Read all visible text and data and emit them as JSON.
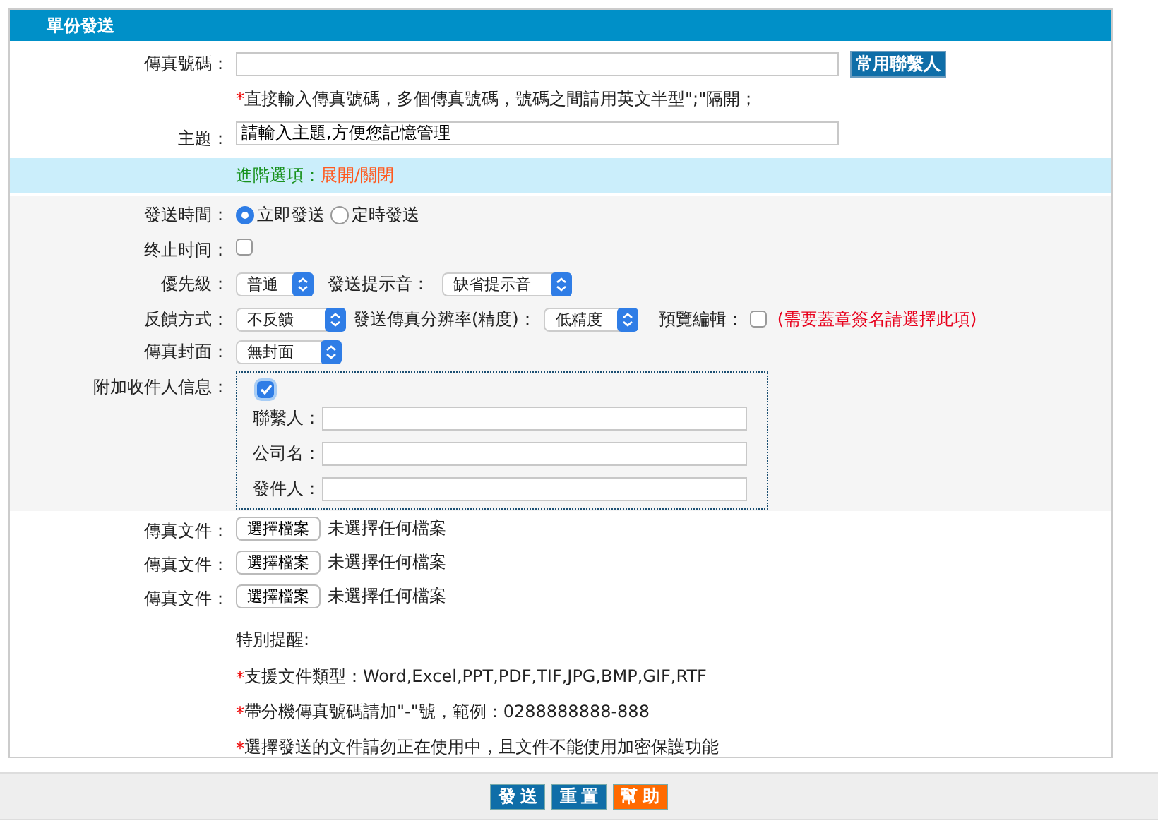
{
  "panel": {
    "title": "單份發送"
  },
  "fax_number": {
    "label": "傳真號碼：",
    "button": "常用聯繫人"
  },
  "fax_hint": {
    "mark": "*",
    "text": "直接輸入傳真號碼，多個傳真號碼，號碼之間請用英文半型\";\"隔開；"
  },
  "subject": {
    "label": "主題：",
    "value": "請輸入主題,方便您記憶管理"
  },
  "advanced": {
    "label": "進階選項：",
    "link": "展開/關閉"
  },
  "send_time": {
    "label": "發送時間：",
    "options": [
      {
        "label": "立即發送",
        "selected": true
      },
      {
        "label": "定時發送",
        "selected": false
      }
    ]
  },
  "stop_time": {
    "label": "终止时间：",
    "checked": false
  },
  "priority": {
    "label": "優先級：",
    "value": "普通"
  },
  "sound": {
    "label": "發送提示音：",
    "value": "缺省提示音"
  },
  "feedback": {
    "label": "反饋方式：",
    "value": "不反饋"
  },
  "resolution": {
    "label": "發送傳真分辨率(精度)：",
    "value": "低精度"
  },
  "preview": {
    "label": "預覽編輯：",
    "checked": false,
    "note": "(需要蓋章簽名請選擇此項)"
  },
  "cover": {
    "label": "傳真封面：",
    "value": "無封面"
  },
  "recipient_info": {
    "label": "附加收件人信息：",
    "checked": true,
    "fields": [
      {
        "label": "聯繫人："
      },
      {
        "label": "公司名："
      },
      {
        "label": "發件人："
      }
    ]
  },
  "files": [
    {
      "label": "傳真文件：",
      "button": "選擇檔案",
      "status": "未選擇任何檔案"
    },
    {
      "label": "傳真文件：",
      "button": "選擇檔案",
      "status": "未選擇任何檔案"
    },
    {
      "label": "傳真文件：",
      "button": "選擇檔案",
      "status": "未選擇任何檔案"
    }
  ],
  "reminder": {
    "title": "特別提醒:",
    "notes": [
      {
        "mark": "*",
        "text": "支援文件類型：Word,Excel,PPT,PDF,TIF,JPG,BMP,GIF,RTF"
      },
      {
        "mark": "*",
        "text": "帶分機傳真號碼請加\"-\"號，範例：0288888888-888"
      },
      {
        "mark": "*",
        "text": "選擇發送的文件請勿正在使用中，且文件不能使用加密保護功能"
      }
    ]
  },
  "buttons": [
    {
      "label": "發 送",
      "kind": "primary"
    },
    {
      "label": "重 置",
      "kind": "primary"
    },
    {
      "label": "幫 助",
      "kind": "help"
    }
  ]
}
